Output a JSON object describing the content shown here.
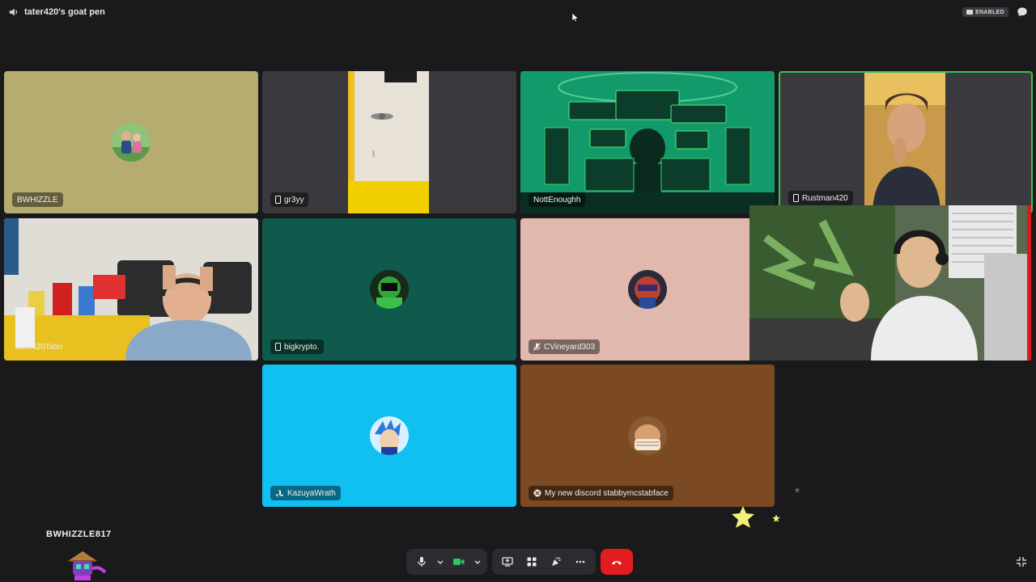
{
  "header": {
    "channel_name": "tater420's goat pen",
    "badge_label": "ENABLED"
  },
  "tiles": [
    {
      "name": "BWHIZZLE",
      "bg": "#b7ac70",
      "platform": "none"
    },
    {
      "name": "gr3yy",
      "bg": "#3a3a3e",
      "platform": "mobile"
    },
    {
      "name": "NottEnoughh",
      "bg": "#1fa86a",
      "platform": "none"
    },
    {
      "name": "Rustman420",
      "bg": "#3a3a3e",
      "platform": "mobile"
    },
    {
      "name": "Tater420Tater",
      "bg": "#c9c4bb",
      "platform": "none"
    },
    {
      "name": "bigkrypto.",
      "bg": "#0f5a4c",
      "platform": "mobile"
    },
    {
      "name": "CVineyard303",
      "bg": "#e0b8ae",
      "platform": "muted"
    },
    {
      "name": "KazuyaWrath",
      "bg": "#10c0f0",
      "platform": "playstation"
    },
    {
      "name": "My new discord stabbymcstabface",
      "bg": "#7b4a22",
      "platform": "xbox"
    }
  ],
  "speaking_color": "#3ec24a",
  "dock": {
    "user_name": "BWHIZZLE817"
  },
  "controls": {
    "icons": [
      "microphone-icon",
      "chevron-down-icon",
      "camera-icon",
      "chevron-down-icon",
      "screen-share-icon",
      "activities-icon",
      "soundboard-icon",
      "more-icon",
      "hang-up-icon"
    ],
    "camera_color": "#2fc45d",
    "hangup_color": "#e31c1f"
  }
}
